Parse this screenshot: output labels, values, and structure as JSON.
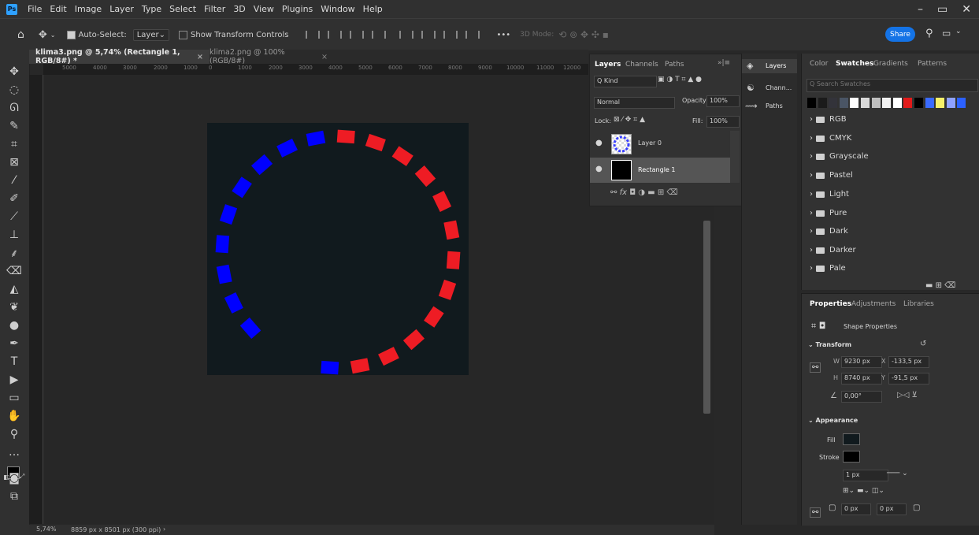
{
  "app": {
    "logo_text": "Ps"
  },
  "menu": [
    "File",
    "Edit",
    "Image",
    "Layer",
    "Type",
    "Select",
    "Filter",
    "3D",
    "View",
    "Plugins",
    "Window",
    "Help"
  ],
  "window_controls": [
    "–",
    "▭",
    "✕"
  ],
  "options": {
    "auto_select_label": "Auto-Select:",
    "auto_select_value": "Layer",
    "show_transform_label": "Show Transform Controls",
    "more_label": "•••",
    "mode_label": "3D Mode:",
    "share_label": "Share"
  },
  "tabs": [
    {
      "label": "klima3.png @ 5,74% (Rectangle 1, RGB/8#) *",
      "active": true
    },
    {
      "label": "klima2.png @ 100% (RGB/8#)",
      "active": false
    }
  ],
  "ruler_ticks": [
    "5000",
    "4000",
    "3000",
    "2000",
    "1000",
    "0",
    "1000",
    "2000",
    "3000",
    "4000",
    "5000",
    "6000",
    "7000",
    "8000",
    "9000",
    "10000",
    "11000",
    "12000"
  ],
  "status": {
    "zoom": "5,74%",
    "doc_info": "8859 px x 8501 px (300 ppi)"
  },
  "layers_panel": {
    "tabs": [
      "Layers",
      "Channels",
      "Paths"
    ],
    "kind_label": "Q Kind",
    "blend_mode": "Normal",
    "opacity_label": "Opacity:",
    "opacity_value": "100%",
    "lock_label": "Lock:",
    "fill_label": "Fill:",
    "fill_value": "100%",
    "layers": [
      {
        "name": "Layer 0",
        "selected": false
      },
      {
        "name": "Rectangle 1",
        "selected": true
      }
    ],
    "footer_icons": [
      "link",
      "fx",
      "mask",
      "adjust",
      "folder",
      "new",
      "trash"
    ]
  },
  "collapsed_panels": [
    {
      "label": "Layers",
      "icon": "layers-icon"
    },
    {
      "label": "Chann...",
      "icon": "channels-icon"
    },
    {
      "label": "Paths",
      "icon": "paths-icon"
    }
  ],
  "swatches_panel": {
    "tabs": [
      "Color",
      "Swatches",
      "Gradients",
      "Patterns"
    ],
    "search_placeholder": "Search Swatches",
    "colors": [
      "#000000",
      "#1b1b1b",
      "#33333a",
      "#4a5565",
      "#ffffff",
      "#d8d8d8",
      "#bfbfbf",
      "#f2f2f2",
      "#ffffff",
      "#e11a1a",
      "#000000",
      "#3a6bff",
      "#f6f06a",
      "#8fa2ff",
      "#2c61ff"
    ],
    "folders": [
      "RGB",
      "CMYK",
      "Grayscale",
      "Pastel",
      "Light",
      "Pure",
      "Dark",
      "Darker",
      "Pale"
    ]
  },
  "properties_panel": {
    "tabs": [
      "Properties",
      "Adjustments",
      "Libraries"
    ],
    "shape_label": "Shape Properties",
    "transform_label": "Transform",
    "w_label": "W",
    "w_value": "9230 px",
    "x_label": "X",
    "x_value": "-133,5 px",
    "h_label": "H",
    "h_value": "8740 px",
    "y_label": "Y",
    "y_value": "-91,5 px",
    "angle_value": "0,00°",
    "appearance_label": "Appearance",
    "fill_label": "Fill",
    "stroke_label": "Stroke",
    "stroke_width": "1 px",
    "corner_1": "0 px",
    "corner_2": "0 px"
  },
  "canvas_art": {
    "blue_color": "#0000ff",
    "red_color": "#ee1c24",
    "background": "#111a1e"
  }
}
